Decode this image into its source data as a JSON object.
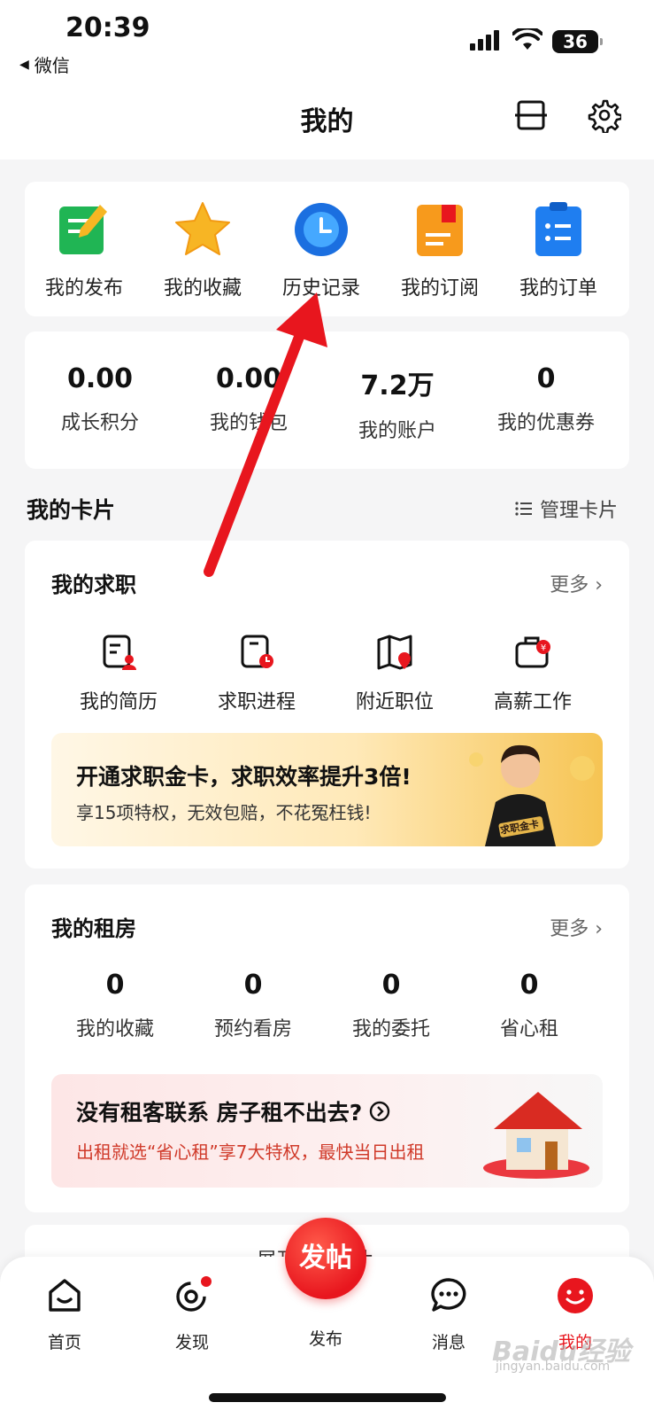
{
  "status_bar": {
    "time": "20:39",
    "back_app": "微信",
    "battery": "36"
  },
  "header": {
    "title": "我的"
  },
  "quick_menu": [
    {
      "label": "我的发布",
      "icon": "publish-icon"
    },
    {
      "label": "我的收藏",
      "icon": "star-icon"
    },
    {
      "label": "历史记录",
      "icon": "history-clock-icon"
    },
    {
      "label": "我的订阅",
      "icon": "subscribe-book-icon"
    },
    {
      "label": "我的订单",
      "icon": "order-list-icon"
    }
  ],
  "stats": [
    {
      "value": "0.00",
      "label": "成长积分"
    },
    {
      "value": "0.00",
      "label": "我的钱包"
    },
    {
      "value": "7.2万",
      "label": "我的账户"
    },
    {
      "value": "0",
      "label": "我的优惠券"
    }
  ],
  "cards_section": {
    "title": "我的卡片",
    "manage_label": "管理卡片"
  },
  "job_card": {
    "title": "我的求职",
    "more_label": "更多 ›",
    "services": [
      {
        "label": "我的简历",
        "icon": "resume-icon"
      },
      {
        "label": "求职进程",
        "icon": "progress-icon"
      },
      {
        "label": "附近职位",
        "icon": "map-pin-icon"
      },
      {
        "label": "高薪工作",
        "icon": "briefcase-icon"
      }
    ],
    "banner": {
      "title": "开通求职金卡，求职效率提升3倍!",
      "subtitle": "享15项特权，无效包赔，不花冤枉钱!",
      "badge": "求职金卡"
    }
  },
  "rent_card": {
    "title": "我的租房",
    "more_label": "更多 ›",
    "stats": [
      {
        "value": "0",
        "label": "我的收藏"
      },
      {
        "value": "0",
        "label": "预约看房"
      },
      {
        "value": "0",
        "label": "我的委托"
      },
      {
        "value": "0",
        "label": "省心租"
      }
    ],
    "banner": {
      "title": "没有租客联系 房子租不出去?",
      "subtitle": "出租就选“省心租”享7大特权，最快当日出租"
    }
  },
  "expand": {
    "label": "展开更多卡片"
  },
  "tabbar": {
    "items": [
      {
        "label": "首页",
        "icon": "home-icon"
      },
      {
        "label": "发现",
        "icon": "discover-icon"
      },
      {
        "label": "发布",
        "icon": "post-icon"
      },
      {
        "label": "消息",
        "icon": "message-icon"
      },
      {
        "label": "我的",
        "icon": "profile-icon"
      }
    ],
    "post_button": "发帖",
    "active_color": "#e8161e"
  },
  "watermark": {
    "brand": "Baidu经验",
    "url": "jingyan.baidu.com"
  }
}
